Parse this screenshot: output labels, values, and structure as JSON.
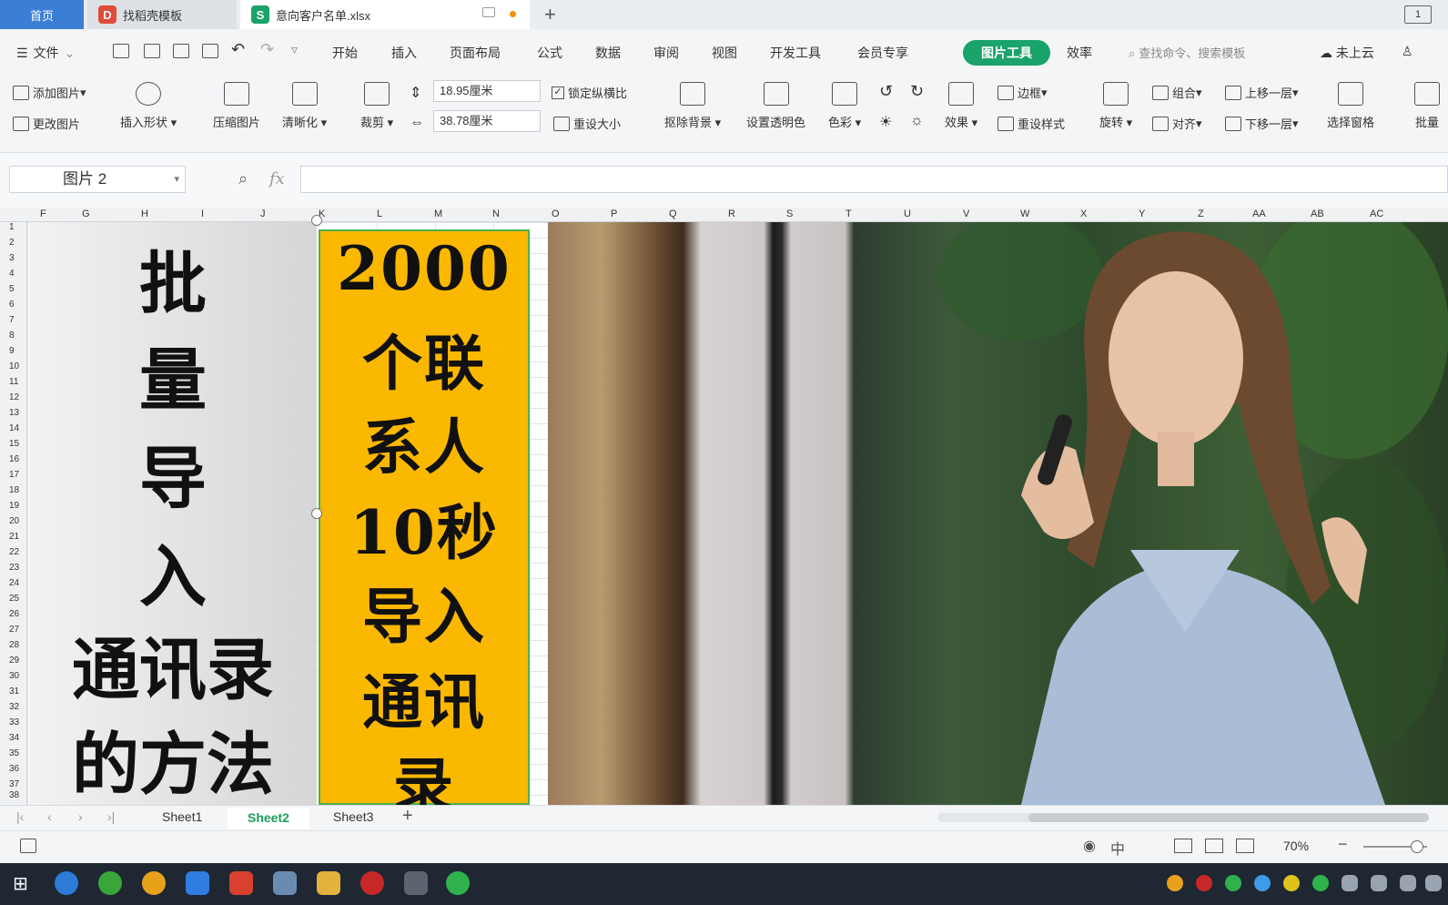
{
  "tabs": {
    "home": "首页",
    "template": "找稻壳模板",
    "file": "意向客户名单.xlsx",
    "plus": "+"
  },
  "menu": {
    "file": "文件",
    "items": [
      "开始",
      "插入",
      "页面布局",
      "公式",
      "数据",
      "审阅",
      "视图",
      "开发工具",
      "会员专享"
    ],
    "active": "图片工具",
    "efficiency": "效率",
    "search_placeholder": "查找命令、搜索模板",
    "cloud": "未上云"
  },
  "ribbon": {
    "add_picture": "添加图片",
    "change_picture": "更改图片",
    "insert_shape": "插入形状",
    "compress_picture": "压缩图片",
    "sharpen": "清晰化",
    "crop": "裁剪",
    "height_value": "18.95厘米",
    "width_value": "38.78厘米",
    "lock_ratio": "锁定纵横比",
    "reset_size": "重设大小",
    "remove_bg": "抠除背景",
    "set_transparent": "设置透明色",
    "color": "色彩",
    "effects": "效果",
    "border": "边框",
    "reset_style": "重设样式",
    "rotate": "旋转",
    "group": "组合",
    "align": "对齐",
    "bring_forward": "上移一层",
    "send_backward": "下移一层",
    "selection_pane": "选择窗格",
    "batch": "批量"
  },
  "formula": {
    "name_box": "图片 2",
    "fx": "fx",
    "value": ""
  },
  "columns": [
    "F",
    "G",
    "H",
    "I",
    "J",
    "K",
    "L",
    "M",
    "N",
    "O",
    "P",
    "Q",
    "R",
    "S",
    "T",
    "U",
    "V",
    "W",
    "X",
    "Y",
    "Z",
    "AA",
    "AB",
    "AC"
  ],
  "rows": [
    "1",
    "2",
    "3",
    "4",
    "5",
    "6",
    "7",
    "8",
    "9",
    "10",
    "11",
    "12",
    "13",
    "14",
    "15",
    "16",
    "17",
    "18",
    "19",
    "20",
    "21",
    "22",
    "23",
    "24",
    "25",
    "26",
    "27",
    "28",
    "29",
    "30",
    "31",
    "32",
    "33",
    "34",
    "35",
    "36",
    "37",
    "38"
  ],
  "left_image": {
    "lines": [
      "批",
      "量",
      "导",
      "入",
      "通讯录",
      "的方法"
    ]
  },
  "middle_image": {
    "lines": [
      "2000",
      "个联",
      "系人",
      "10秒",
      "导入",
      "通讯",
      "录"
    ],
    "background": "#fbb800"
  },
  "sheets": {
    "tabs": [
      "Sheet1",
      "Sheet2",
      "Sheet3"
    ],
    "active": "Sheet2",
    "add": "+"
  },
  "status": {
    "zoom": "70%"
  },
  "colors": {
    "accent_green": "#1aa36a",
    "home_tab_blue": "#3b7ed6",
    "taskbar": "#1f2733"
  }
}
